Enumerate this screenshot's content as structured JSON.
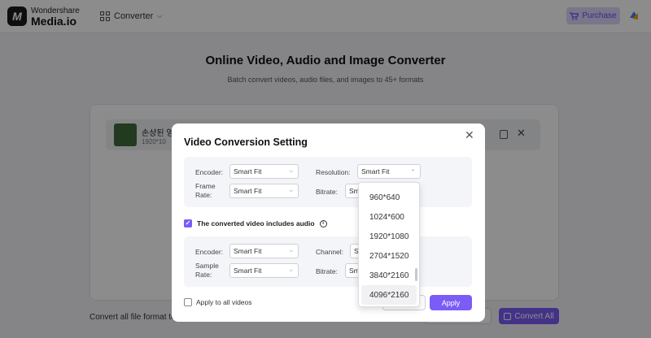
{
  "app": {
    "logo_letter": "M",
    "brand_small": "Wondershare",
    "brand_main": "Media.io",
    "nav_label": "Converter",
    "purchase_label": "Purchase"
  },
  "page": {
    "title": "Online Video, Audio and Image Converter",
    "subtitle": "Batch convert videos, audio files, and images to 45+ formats",
    "file_name": "손상된 영",
    "file_meta": "1920*10",
    "convert_all_format_label": "Convert all file format to:",
    "convert_all_button": "Convert All"
  },
  "modal": {
    "title": "Video Conversion Setting",
    "video": {
      "encoder_label": "Encoder:",
      "encoder_value": "Smart Fit",
      "resolution_label": "Resolution:",
      "resolution_value": "Smart Fit",
      "frame_rate_label": "Frame Rate:",
      "frame_rate_value": "Smart Fit",
      "bitrate_label": "Bitrate:",
      "bitrate_value": "Sm"
    },
    "audio_checkbox_label": "The converted video includes audio",
    "audio": {
      "encoder_label": "Encoder:",
      "encoder_value": "Smart Fit",
      "channel_label": "Channel:",
      "channel_value": "S",
      "sample_rate_label": "Sample Rate:",
      "sample_rate_value": "Smart Fit",
      "bitrate_label": "Bitrate:",
      "bitrate_value": "Sm"
    },
    "apply_all_label": "Apply to all videos",
    "apply_button": "Apply"
  },
  "resolution_options": [
    "960*640",
    "1024*600",
    "1920*1080",
    "2704*1520",
    "3840*2160",
    "4096*2160"
  ],
  "colors": {
    "accent": "#7c5cf6",
    "purchase_bg": "#ddd6fb",
    "purchase_text": "#6d48f2"
  }
}
